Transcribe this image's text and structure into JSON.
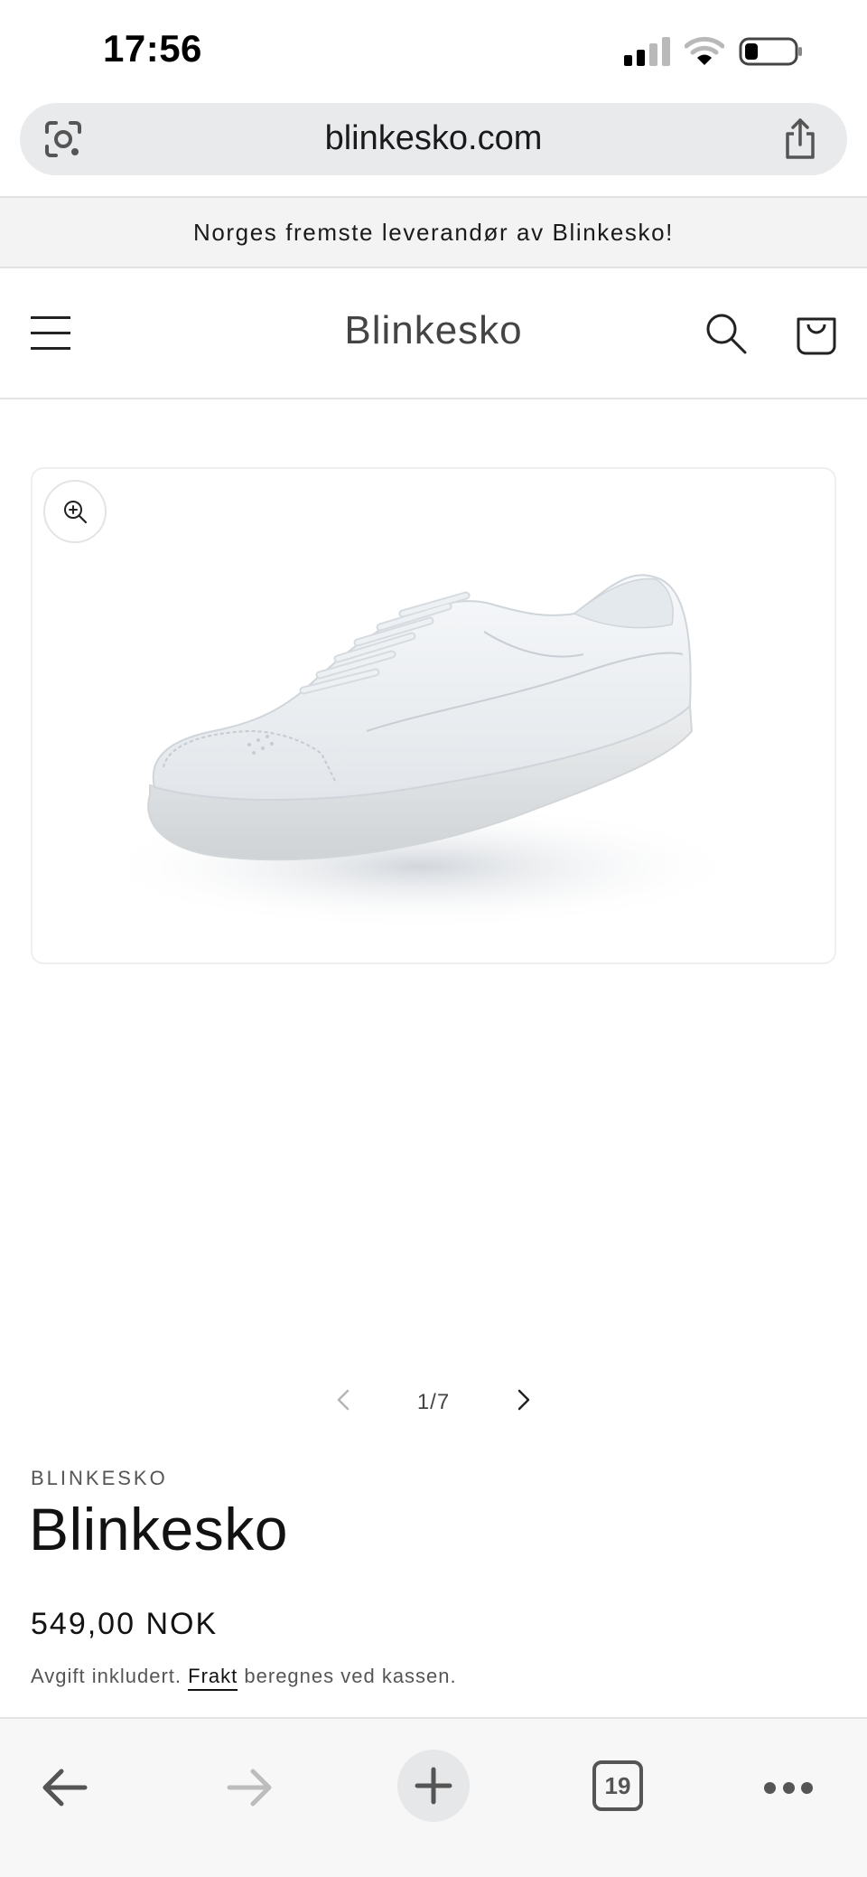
{
  "status_bar": {
    "time": "17:56"
  },
  "browser": {
    "url": "blinkesko.com",
    "icons": {
      "lens": "google-lens-icon",
      "share": "share-icon"
    }
  },
  "announcement": {
    "text": "Norges fremste leverandør av Blinkesko!"
  },
  "header": {
    "site_title": "Blinkesko",
    "icons": [
      "menu-icon",
      "search-icon",
      "cart-icon"
    ]
  },
  "product": {
    "image_alt": "white-sneaker",
    "slide_counter": "1/7",
    "vendor": "BLINKESKO",
    "title": "Blinkesko",
    "price": "549,00 NOK",
    "tax_note_prefix": "Avgift inkludert.",
    "shipping_link": "Frakt",
    "tax_note_suffix": "beregnes ved kassen."
  },
  "toolbar": {
    "tab_count": "19",
    "icons": [
      "back-icon",
      "forward-icon",
      "new-tab-icon",
      "tabs-icon",
      "more-icon"
    ]
  },
  "colors": {
    "background": "#ffffff",
    "announcement_bg": "#f3f3f3",
    "text": "#121212",
    "url_bar_bg": "#e8eaec"
  }
}
